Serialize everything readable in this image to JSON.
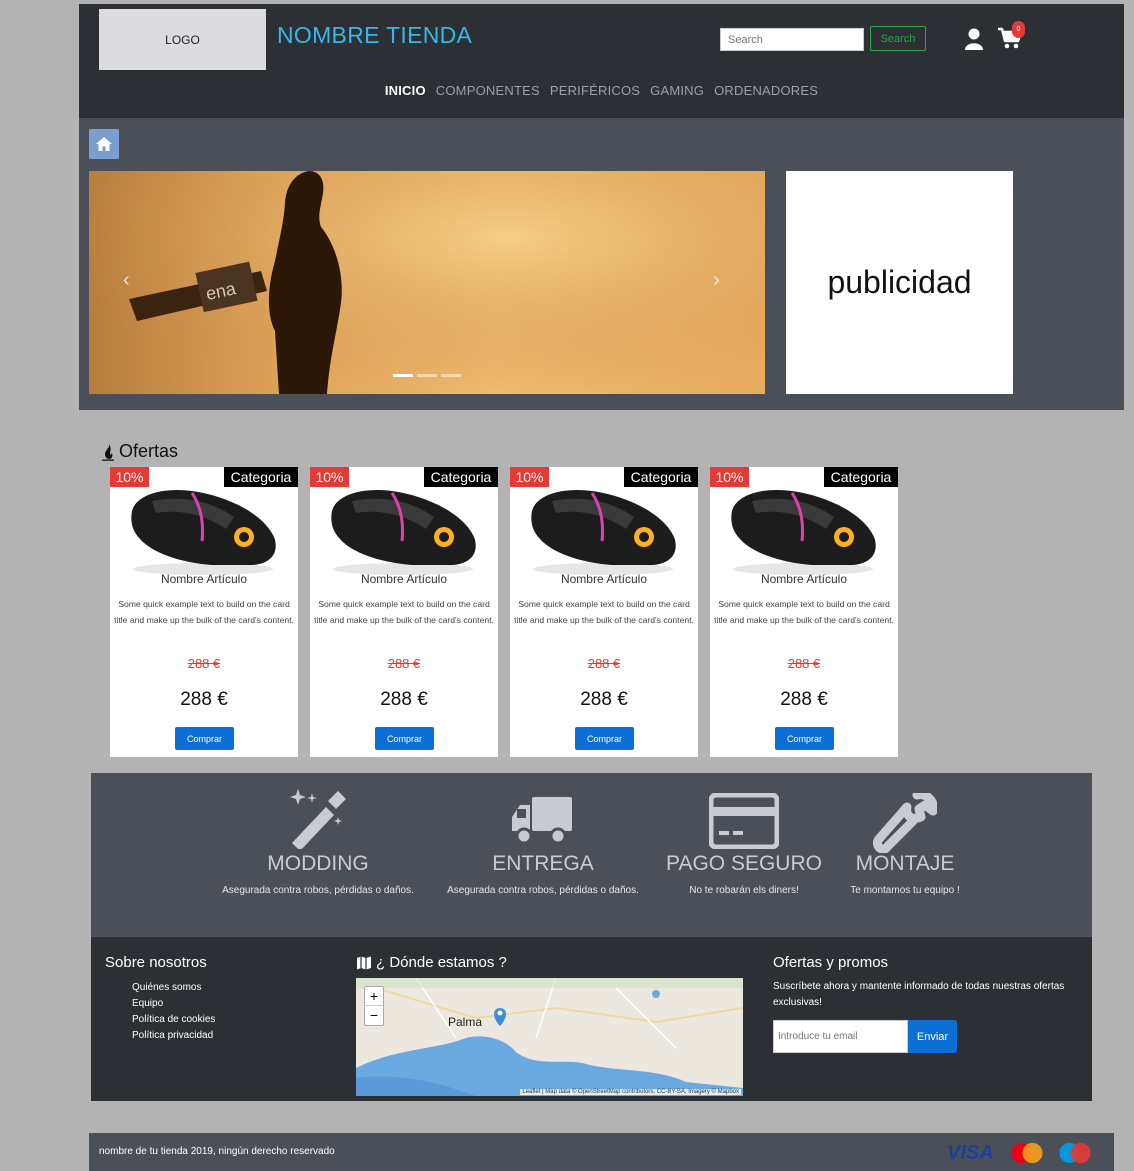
{
  "header": {
    "logo": "LOGO",
    "store_name": "NOMBRE TIENDA",
    "search_placeholder": "Search",
    "search_button": "Search",
    "cart_count": "0"
  },
  "nav": [
    {
      "label": "INICIO",
      "active": true
    },
    {
      "label": "COMPONENTES"
    },
    {
      "label": "PERIFÉRICOS"
    },
    {
      "label": "GAMING"
    },
    {
      "label": "ORDENADORES"
    }
  ],
  "hero": {
    "ad_text": "publicidad"
  },
  "offers": {
    "title": "Ofertas",
    "cards": [
      {
        "discount": "10%",
        "category": "Categoria",
        "name": "Nombre Artículo",
        "desc": "Some quick example text to build on the card title and make up the bulk of the card's content.",
        "old_price": "288 €",
        "price": "288 €",
        "button": "Comprar"
      },
      {
        "discount": "10%",
        "category": "Categoria",
        "name": "Nombre Artículo",
        "desc": "Some quick example text to build on the card title and make up the bulk of the card's content.",
        "old_price": "288 €",
        "price": "288 €",
        "button": "Comprar"
      },
      {
        "discount": "10%",
        "category": "Categoria",
        "name": "Nombre Artículo",
        "desc": "Some quick example text to build on the card title and make up the bulk of the card's content.",
        "old_price": "288 €",
        "price": "288 €",
        "button": "Comprar"
      },
      {
        "discount": "10%",
        "category": "Categoria",
        "name": "Nombre Artículo",
        "desc": "Some quick example text to build on the card title and make up the bulk of the card's content.",
        "old_price": "288 €",
        "price": "288 €",
        "button": "Comprar"
      }
    ]
  },
  "features": [
    {
      "icon": "magic-wand-icon",
      "title": "MODDING",
      "subtitle": "Asegurada contra robos, pérdidas o daños."
    },
    {
      "icon": "truck-icon",
      "title": "ENTREGA",
      "subtitle": "Asegurada contra robos, pérdidas o daños."
    },
    {
      "icon": "credit-card-icon",
      "title": "PAGO SEGURO",
      "subtitle": "No te robarán els diners!"
    },
    {
      "icon": "wrench-icon",
      "title": "MONTAJE",
      "subtitle": "Te montamos tu equipo !"
    }
  ],
  "footer": {
    "about_title": "Sobre nosotros",
    "links": [
      "Quiénes somos",
      "Equipo",
      "Política de cookies",
      "Política privacidad"
    ],
    "map_title": "¿ Dónde estamos ?",
    "map_city": "Palma",
    "map_zoom_in": "+",
    "map_zoom_out": "−",
    "map_attribution": "Leaflet | Map data © OpenStreetMap contributors, CC-BY-SA, Imagery © Mapbox",
    "promo_title": "Ofertas y promos",
    "promo_text": "Suscríbete ahora y mantente informado de todas nuestras ofertas exclusivas!",
    "email_placeholder": "Introduce tu email",
    "send_button": "Enviar"
  },
  "bottom": {
    "copyright": "nombre de tu tienda 2019, ningún derecho reservado",
    "payment_visa": "VISA",
    "payment_mastercard": "MasterCard",
    "payment_maestro": "Maestro"
  },
  "colors": {
    "header_bg": "#2c3035",
    "hero_bg": "#4b5058",
    "brand_blue": "#38b7e6",
    "discount_red": "#e53935",
    "button_blue": "#0b6fd6",
    "search_green": "#28a745"
  }
}
